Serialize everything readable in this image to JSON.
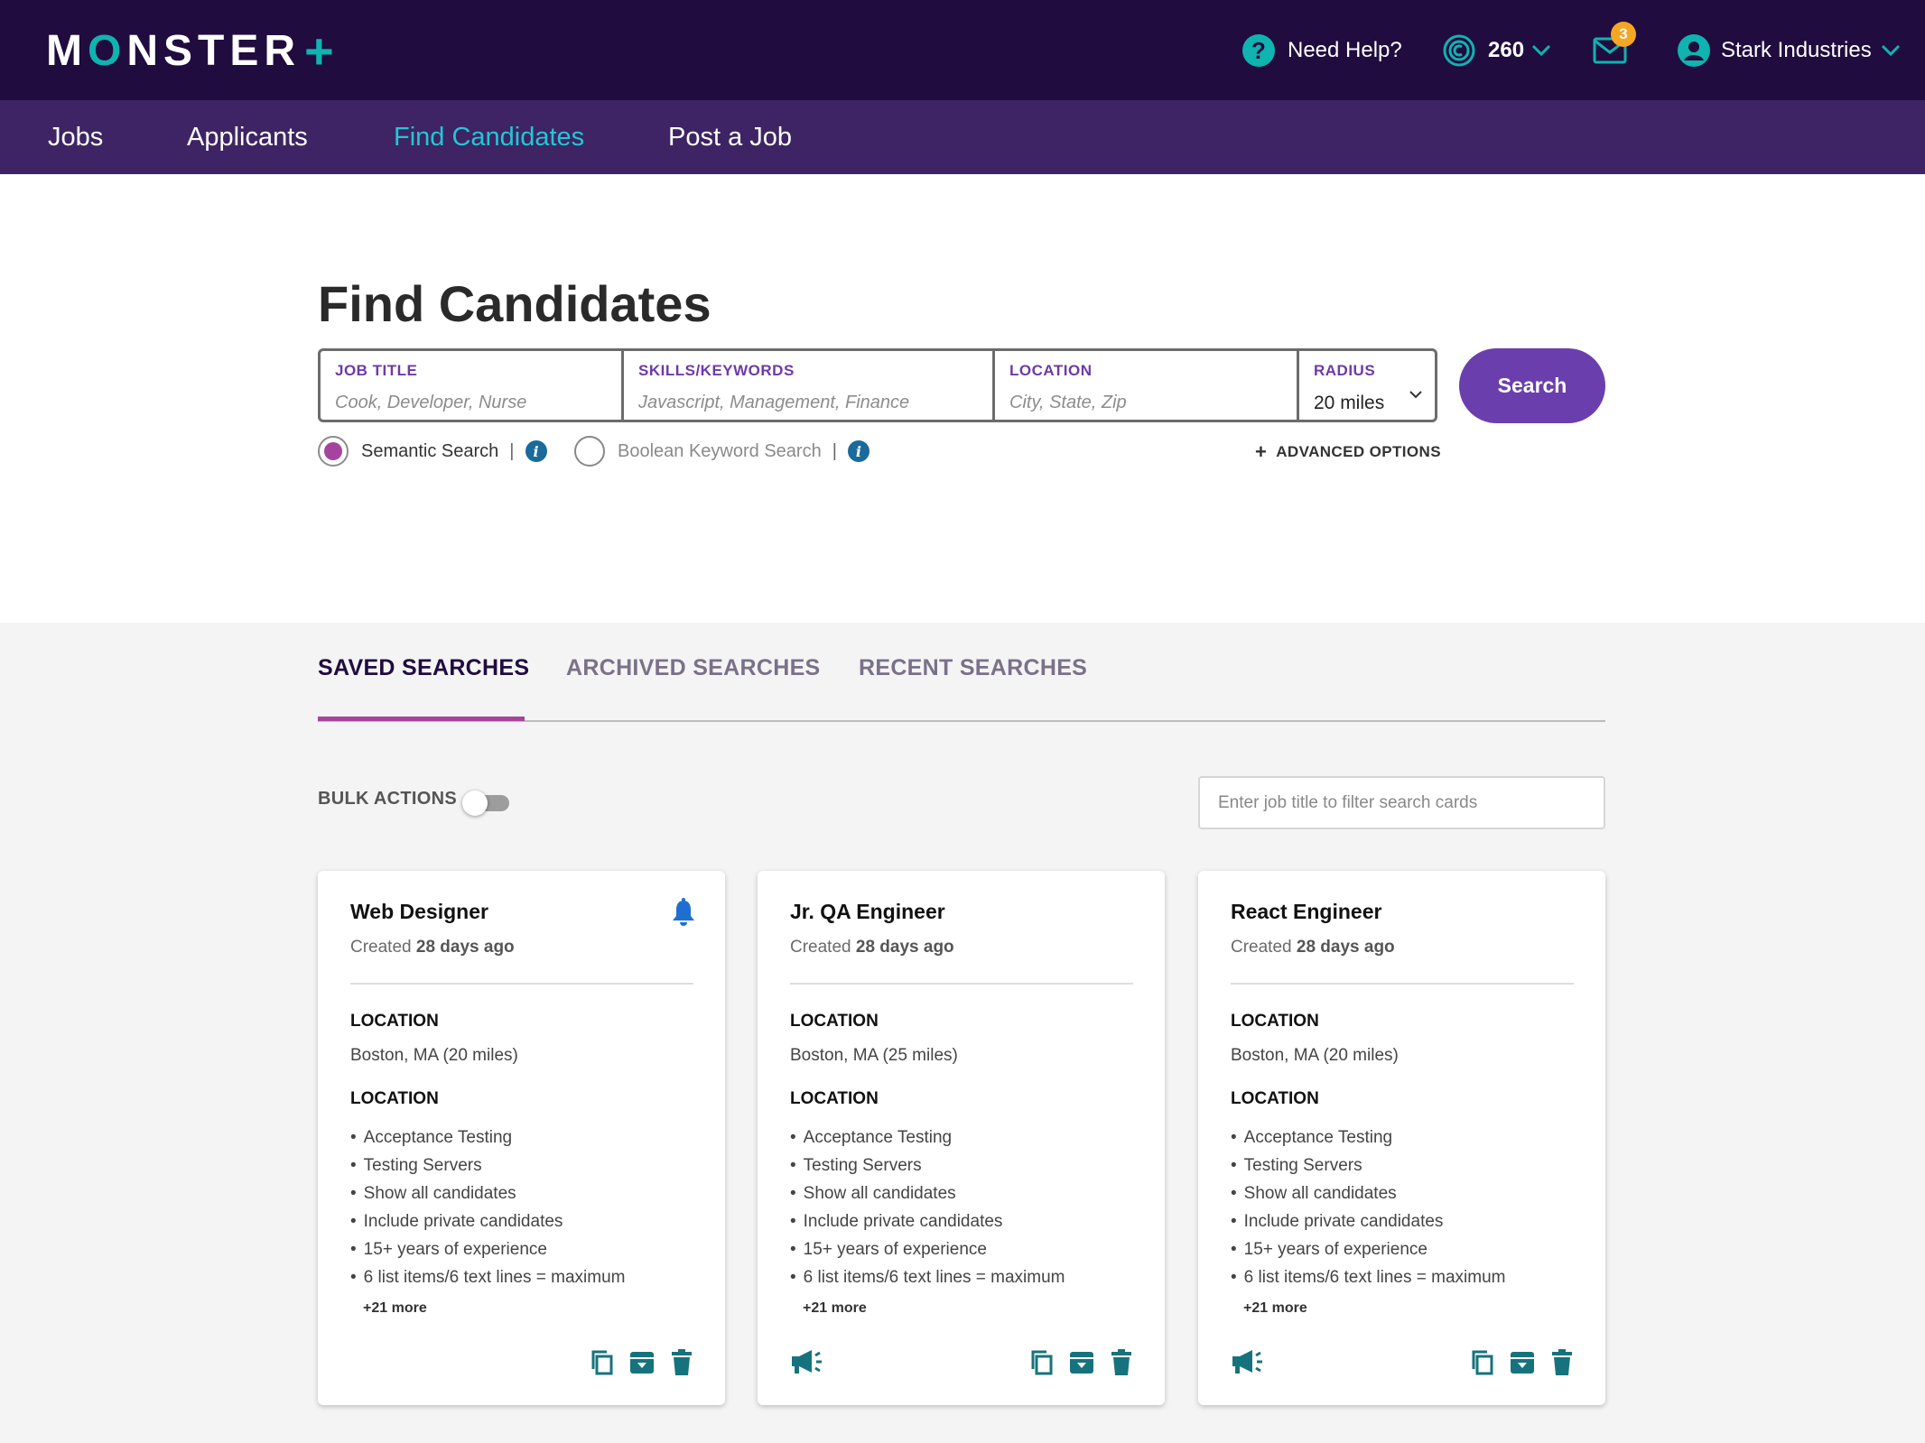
{
  "header": {
    "logo_main": "M",
    "logo_o": "O",
    "logo_rest": "NSTER",
    "logo_plus": "+",
    "help_label": "Need Help?",
    "credits": "260",
    "mail_badge": "3",
    "account_name": "Stark Industries"
  },
  "nav": {
    "items": [
      "Jobs",
      "Applicants",
      "Find Candidates",
      "Post a Job"
    ],
    "active": "Find Candidates"
  },
  "search": {
    "page_title": "Find Candidates",
    "job_title_label": "JOB TITLE",
    "job_title_placeholder": "Cook, Developer, Nurse",
    "skills_label": "SKILLS/KEYWORDS",
    "skills_placeholder": "Javascript, Management, Finance",
    "location_label": "LOCATION",
    "location_placeholder": "City, State, Zip",
    "radius_label": "RADIUS",
    "radius_value": "20 miles",
    "button": "Search",
    "semantic_label": "Semantic Search",
    "boolean_label": "Boolean Keyword Search",
    "advanced_label": "ADVANCED OPTIONS",
    "pipe": "|",
    "info_glyph": "i"
  },
  "tabs": {
    "saved": "SAVED SEARCHES",
    "archived": "ARCHIVED SEARCHES",
    "recent": "RECENT SEARCHES"
  },
  "toolbar": {
    "bulk_label": "BULK ACTIONS",
    "filter_placeholder": "Enter job title to filter search cards"
  },
  "cards": [
    {
      "title": "Web Designer",
      "created_prefix": "Created",
      "created_age": "28 days ago",
      "location_heading": "LOCATION",
      "location": "Boston, MA (20 miles)",
      "criteria_heading": "LOCATION",
      "items": [
        "Acceptance Testing",
        "Testing Servers",
        "Show all candidates",
        "Include private candidates",
        "15+ years of experience",
        "6 list items/6 text lines = maximum"
      ],
      "more": "+21 more"
    },
    {
      "title": "Jr. QA Engineer",
      "created_prefix": "Created",
      "created_age": "28 days ago",
      "location_heading": "LOCATION",
      "location": "Boston, MA (25 miles)",
      "criteria_heading": "LOCATION",
      "items": [
        "Acceptance Testing",
        "Testing Servers",
        "Show all candidates",
        "Include private candidates",
        "15+ years of experience",
        "6 list items/6 text lines = maximum"
      ],
      "more": "+21 more"
    },
    {
      "title": "React Engineer",
      "created_prefix": "Created",
      "created_age": "28 days ago",
      "location_heading": "LOCATION",
      "location": "Boston, MA (20 miles)",
      "criteria_heading": "LOCATION",
      "items": [
        "Acceptance Testing",
        "Testing Servers",
        "Show all candidates",
        "Include private candidates",
        "15+ years of experience",
        "6 list items/6 text lines = maximum"
      ],
      "more": "+21 more"
    }
  ],
  "colors": {
    "header_bg": "#200c3e",
    "nav_bg": "#3e2464",
    "accent_teal": "#0fb3b0",
    "nav_active": "#22c7d4",
    "button_purple": "#6a3fad",
    "tab_underline": "#a5449f",
    "icon_teal": "#16737d",
    "bell_blue": "#1f6fd1",
    "badge_orange": "#f5a623"
  },
  "icons": {
    "help": "question-circle-icon",
    "credits": "credits-coin-icon",
    "mail": "mail-icon",
    "account": "user-circle-icon",
    "bell": "bell-icon",
    "copy": "copy-icon",
    "archive": "archive-icon",
    "delete": "trash-icon",
    "promote": "megaphone-icon"
  }
}
